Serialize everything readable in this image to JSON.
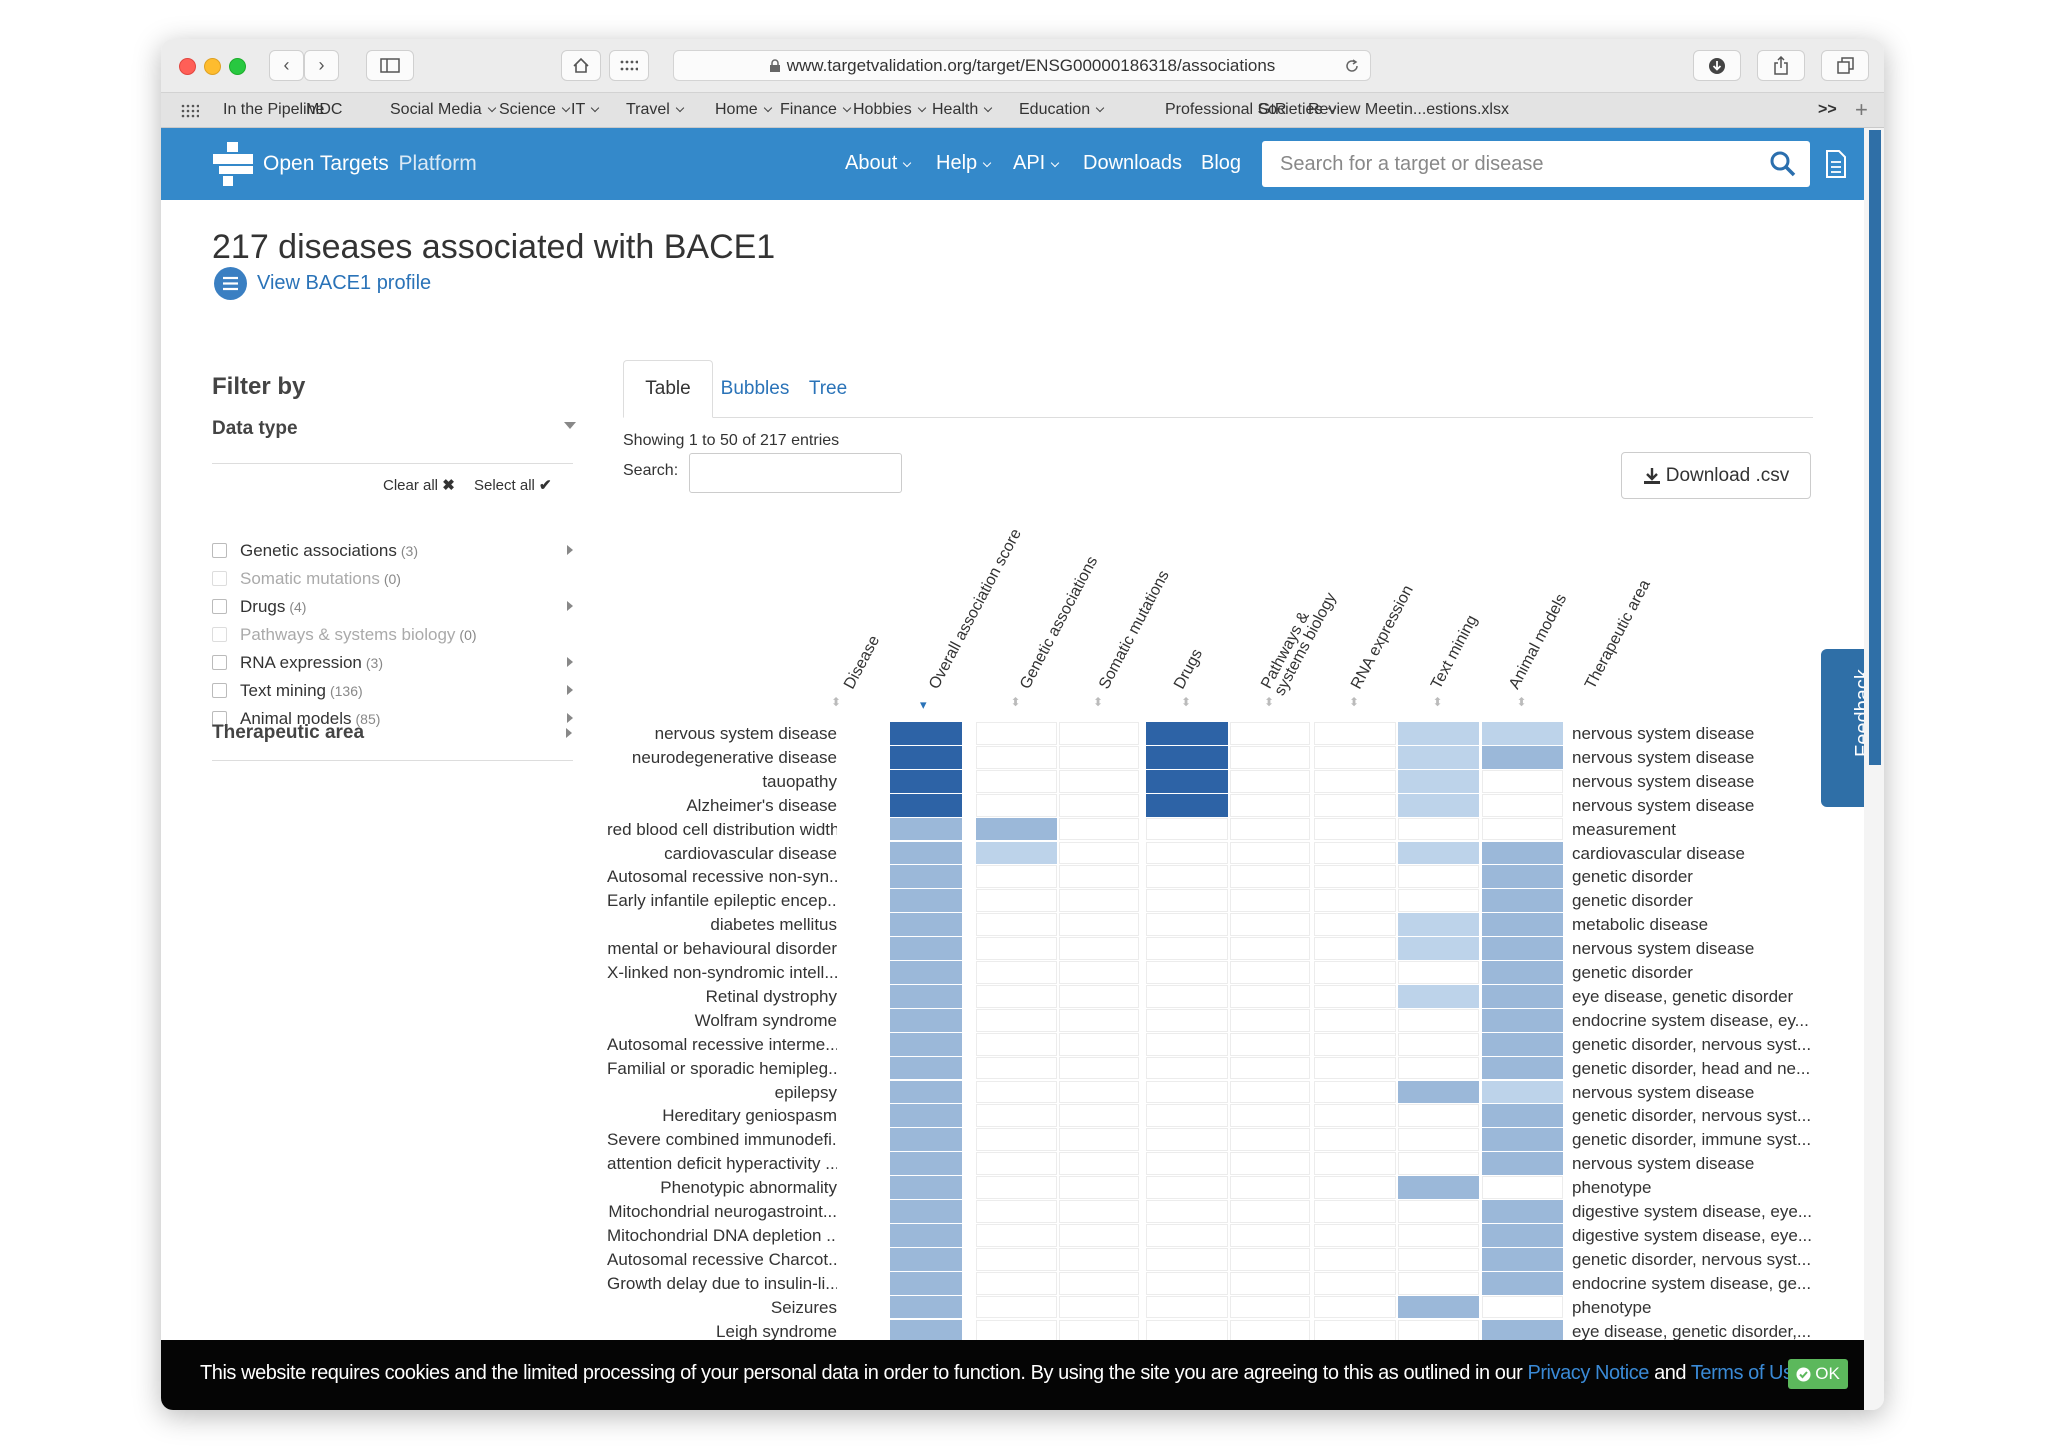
{
  "browser": {
    "url": "www.targetvalidation.org/target/ENSG00000186318/associations",
    "bookmarks": [
      {
        "label": "In the Pipeline",
        "dropdown": false
      },
      {
        "label": "MDC",
        "dropdown": false
      },
      {
        "label": "Social Media",
        "dropdown": true
      },
      {
        "label": "Science",
        "dropdown": true
      },
      {
        "label": "IT",
        "dropdown": true
      },
      {
        "label": "Travel",
        "dropdown": true
      },
      {
        "label": "Home",
        "dropdown": true
      },
      {
        "label": "Finance",
        "dropdown": true
      },
      {
        "label": "Hobbies",
        "dropdown": true
      },
      {
        "label": "Health",
        "dropdown": true
      },
      {
        "label": "Education",
        "dropdown": true
      },
      {
        "label": "Professional Societies",
        "dropdown": true
      },
      {
        "label": "GtR",
        "dropdown": false
      },
      {
        "label": "Review Meetin...estions.xlsx",
        "dropdown": false
      }
    ],
    "overflow": ">>"
  },
  "site": {
    "logo_main": "Open Targets",
    "logo_sub": "Platform",
    "nav": [
      {
        "label": "About",
        "dropdown": true
      },
      {
        "label": "Help",
        "dropdown": true
      },
      {
        "label": "API",
        "dropdown": true
      },
      {
        "label": "Downloads",
        "dropdown": false
      },
      {
        "label": "Blog",
        "dropdown": false
      }
    ],
    "search_placeholder": "Search for a target or disease"
  },
  "page": {
    "title": "217 diseases associated with BACE1",
    "profile_link": "View BACE1 profile"
  },
  "filter": {
    "heading": "Filter by",
    "data_type": "Data type",
    "clear_all": "Clear all",
    "select_all": "Select all",
    "items": [
      {
        "label": "Genetic associations",
        "count": "(3)",
        "enabled": true
      },
      {
        "label": "Somatic mutations",
        "count": "(0)",
        "enabled": false
      },
      {
        "label": "Drugs",
        "count": "(4)",
        "enabled": true
      },
      {
        "label": "Pathways & systems biology",
        "count": "(0)",
        "enabled": false
      },
      {
        "label": "RNA expression",
        "count": "(3)",
        "enabled": true
      },
      {
        "label": "Text mining",
        "count": "(136)",
        "enabled": true
      },
      {
        "label": "Animal models",
        "count": "(85)",
        "enabled": true
      }
    ],
    "therapeutic_area": "Therapeutic area"
  },
  "tabs": [
    "Table",
    "Bubbles",
    "Tree"
  ],
  "active_tab": "Table",
  "table": {
    "showing": "Showing 1 to 50 of 217 entries",
    "search_label": "Search:",
    "download": "Download .csv",
    "columns": [
      "Disease",
      "Overall association score",
      "Genetic associations",
      "Somatic mutations",
      "Drugs",
      "Pathways & systems biology",
      "RNA expression",
      "Text mining",
      "Animal models",
      "Therapeutic area"
    ],
    "levels_note": "heatmap cell shading (0 = empty, 1 = light, 2 = medium, 3 = strong)",
    "rows": [
      {
        "disease": "nervous system disease",
        "area": "nervous system disease",
        "scores": [
          3,
          0,
          0,
          3,
          0,
          0,
          1,
          1
        ]
      },
      {
        "disease": "neurodegenerative disease",
        "area": "nervous system disease",
        "scores": [
          3,
          0,
          0,
          3,
          0,
          0,
          1,
          2
        ]
      },
      {
        "disease": "tauopathy",
        "area": "nervous system disease",
        "scores": [
          3,
          0,
          0,
          3,
          0,
          0,
          1,
          0
        ]
      },
      {
        "disease": "Alzheimer's disease",
        "area": "nervous system disease",
        "scores": [
          3,
          0,
          0,
          3,
          0,
          0,
          1,
          0
        ]
      },
      {
        "disease": "red blood cell distribution width",
        "area": "measurement",
        "scores": [
          2,
          2,
          0,
          0,
          0,
          0,
          0,
          0
        ]
      },
      {
        "disease": "cardiovascular disease",
        "area": "cardiovascular disease",
        "scores": [
          2,
          1,
          0,
          0,
          0,
          0,
          1,
          2
        ]
      },
      {
        "disease": "Autosomal recessive non-syn...",
        "area": "genetic disorder",
        "scores": [
          2,
          0,
          0,
          0,
          0,
          0,
          0,
          2
        ]
      },
      {
        "disease": "Early infantile epileptic encep...",
        "area": "genetic disorder",
        "scores": [
          2,
          0,
          0,
          0,
          0,
          0,
          0,
          2
        ]
      },
      {
        "disease": "diabetes mellitus",
        "area": "metabolic disease",
        "scores": [
          2,
          0,
          0,
          0,
          0,
          0,
          1,
          2
        ]
      },
      {
        "disease": "mental or behavioural disorder",
        "area": "nervous system disease",
        "scores": [
          2,
          0,
          0,
          0,
          0,
          0,
          1,
          2
        ]
      },
      {
        "disease": "X-linked non-syndromic intell...",
        "area": "genetic disorder",
        "scores": [
          2,
          0,
          0,
          0,
          0,
          0,
          0,
          2
        ]
      },
      {
        "disease": "Retinal dystrophy",
        "area": "eye disease, genetic disorder",
        "scores": [
          2,
          0,
          0,
          0,
          0,
          0,
          1,
          2
        ]
      },
      {
        "disease": "Wolfram syndrome",
        "area": "endocrine system disease, ey...",
        "scores": [
          2,
          0,
          0,
          0,
          0,
          0,
          0,
          2
        ]
      },
      {
        "disease": "Autosomal recessive interme...",
        "area": "genetic disorder, nervous syst...",
        "scores": [
          2,
          0,
          0,
          0,
          0,
          0,
          0,
          2
        ]
      },
      {
        "disease": "Familial or sporadic hemipleg...",
        "area": "genetic disorder, head and ne...",
        "scores": [
          2,
          0,
          0,
          0,
          0,
          0,
          0,
          2
        ]
      },
      {
        "disease": "epilepsy",
        "area": "nervous system disease",
        "scores": [
          2,
          0,
          0,
          0,
          0,
          0,
          2,
          1
        ]
      },
      {
        "disease": "Hereditary geniospasm",
        "area": "genetic disorder, nervous syst...",
        "scores": [
          2,
          0,
          0,
          0,
          0,
          0,
          0,
          2
        ]
      },
      {
        "disease": "Severe combined immunodefi...",
        "area": "genetic disorder, immune syst...",
        "scores": [
          2,
          0,
          0,
          0,
          0,
          0,
          0,
          2
        ]
      },
      {
        "disease": "attention deficit hyperactivity ...",
        "area": "nervous system disease",
        "scores": [
          2,
          0,
          0,
          0,
          0,
          0,
          0,
          2
        ]
      },
      {
        "disease": "Phenotypic abnormality",
        "area": "phenotype",
        "scores": [
          2,
          0,
          0,
          0,
          0,
          0,
          2,
          0
        ]
      },
      {
        "disease": "Mitochondrial neurogastroint...",
        "area": "digestive system disease, eye...",
        "scores": [
          2,
          0,
          0,
          0,
          0,
          0,
          0,
          2
        ]
      },
      {
        "disease": "Mitochondrial DNA depletion ...",
        "area": "digestive system disease, eye...",
        "scores": [
          2,
          0,
          0,
          0,
          0,
          0,
          0,
          2
        ]
      },
      {
        "disease": "Autosomal recessive Charcot...",
        "area": "genetic disorder, nervous syst...",
        "scores": [
          2,
          0,
          0,
          0,
          0,
          0,
          0,
          2
        ]
      },
      {
        "disease": "Growth delay due to insulin-li...",
        "area": "endocrine system disease, ge...",
        "scores": [
          2,
          0,
          0,
          0,
          0,
          0,
          0,
          2
        ]
      },
      {
        "disease": "Seizures",
        "area": "phenotype",
        "scores": [
          2,
          0,
          0,
          0,
          0,
          0,
          2,
          0
        ]
      },
      {
        "disease": "Leigh syndrome",
        "area": "eye disease, genetic disorder,...",
        "scores": [
          2,
          0,
          0,
          0,
          0,
          0,
          0,
          2
        ]
      }
    ]
  },
  "feedback": "Feedback",
  "cookie": {
    "text": "This website requires cookies and the limited processing of your personal data in order to function. By using the site you are agreeing to this as outlined in our",
    "privacy": "Privacy Notice",
    "and": "and",
    "terms": "Terms of Use.",
    "ok": "OK"
  },
  "colors": {
    "nav_bg": "#3489ca",
    "level_1": "#bdd3ea",
    "level_2": "#9bb8d9",
    "level_3": "#2d63a6",
    "link": "#2a73b8",
    "ok_green": "#5cb85c"
  }
}
